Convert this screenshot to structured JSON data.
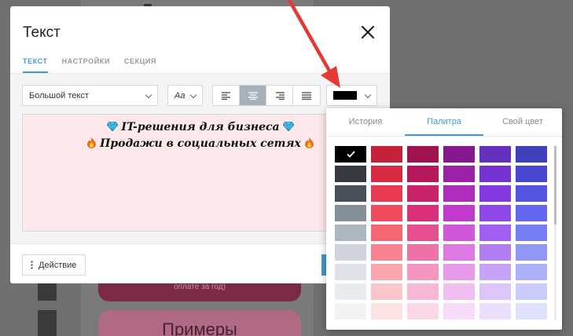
{
  "modal": {
    "title": "Текст",
    "tabs": [
      {
        "label": "ТЕКСТ",
        "active": true
      },
      {
        "label": "НАСТРОЙКИ",
        "active": false
      },
      {
        "label": "СЕКЦИЯ",
        "active": false
      }
    ],
    "style_select": {
      "value": "Большой текст"
    },
    "font_select": {
      "value": "Аа"
    },
    "alignment": [
      "left",
      "center",
      "right",
      "justify"
    ],
    "selected_alignment": "center",
    "color_value": "#000000",
    "editor_lines": [
      "IT-решения для бизнеса",
      "Продажи в социальных сетях"
    ],
    "action_label": "Действие"
  },
  "palette_popup": {
    "tabs": [
      {
        "label": "История",
        "active": false
      },
      {
        "label": "Палитра",
        "active": true
      },
      {
        "label": "Свой цвет",
        "active": false
      }
    ],
    "selected": "#000000",
    "rows": [
      [
        "#000000",
        "#c4213a",
        "#a01350",
        "#86188f",
        "#6530bd",
        "#3f3fb9"
      ],
      [
        "#343a40",
        "#d72b43",
        "#b5185b",
        "#9b21a6",
        "#7532d1",
        "#4646d0"
      ],
      [
        "#495057",
        "#e83a50",
        "#ca2369",
        "#ae2cbb",
        "#8338e0",
        "#5354e0"
      ],
      [
        "#868e96",
        "#f24b5e",
        "#d93079",
        "#c23acd",
        "#9047ea",
        "#6366ef"
      ],
      [
        "#adb5bd",
        "#f56673",
        "#e44f8f",
        "#d157da",
        "#a05ff0",
        "#777ef3"
      ],
      [
        "#ced4da",
        "#f78490",
        "#ee72a8",
        "#dc79e3",
        "#b27ef4",
        "#8f96f6"
      ],
      [
        "#dee2e6",
        "#f9a7ae",
        "#f496c0",
        "#e79ceb",
        "#c7a3f7",
        "#aeb3f8"
      ],
      [
        "#e9ecef",
        "#fbc6ca",
        "#f8b8d5",
        "#efbff2",
        "#dbc5fa",
        "#c9ccfb"
      ],
      [
        "#f1f3f5",
        "#fde2e4",
        "#fbd7e7",
        "#f6dcf8",
        "#ebe0fc",
        "#e0e2fd"
      ]
    ]
  },
  "background": {
    "button_dark_text": "оплате за год)",
    "button_pink_text": "Примеры"
  }
}
